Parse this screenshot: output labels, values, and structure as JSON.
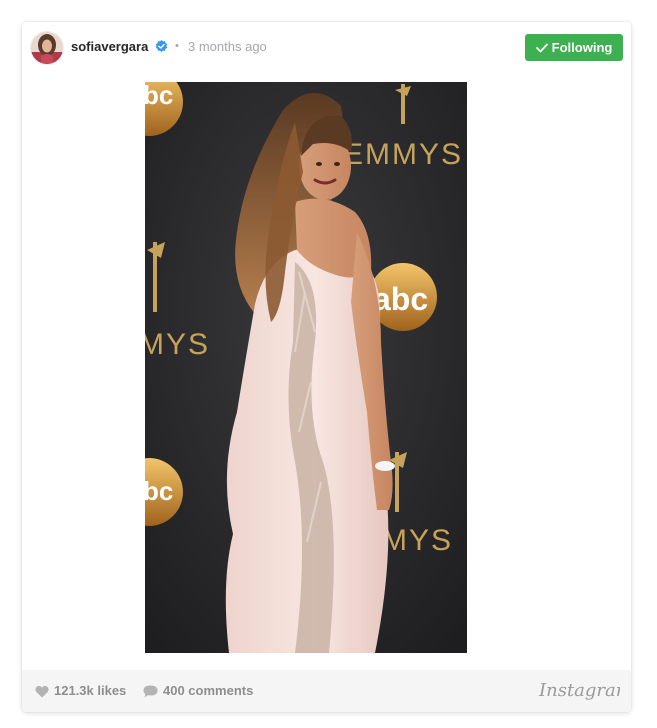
{
  "post": {
    "username": "sofiavergara",
    "dot": "•",
    "time_ago": "3 months ago",
    "verified": true,
    "follow_button_label": "Following",
    "likes": "121.3k likes",
    "comments": "400 comments",
    "brand": "Instagram"
  },
  "colors": {
    "follow_green": "#3db051",
    "backdrop_dark": "#2a2a2c",
    "backdrop_gold": "#c6a25a",
    "dress": "#f3dcd6"
  },
  "icons": {
    "verified": "verified-badge-icon",
    "check": "check-icon",
    "heart": "heart-icon",
    "comment": "comment-bubble-icon"
  }
}
